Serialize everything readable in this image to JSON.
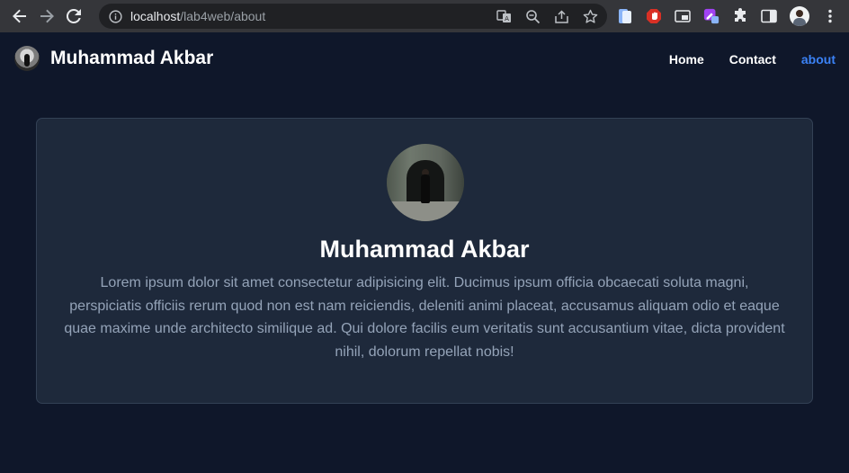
{
  "browser": {
    "url_host": "localhost",
    "url_path": "/lab4web/about"
  },
  "site": {
    "brand_name": "Muhammad Akbar",
    "menu": [
      {
        "label": "Home",
        "active": false
      },
      {
        "label": "Contact",
        "active": false
      },
      {
        "label": "about",
        "active": true
      }
    ]
  },
  "card": {
    "title": "Muhammad Akbar",
    "text": "Lorem ipsum dolor sit amet consectetur adipisicing elit. Ducimus ipsum officia obcaecati soluta magni, perspiciatis officiis rerum quod non est nam reiciendis, deleniti animi placeat, accusamus aliquam odio et eaque quae maxime unde architecto similique ad. Qui dolore facilis eum veritatis sunt accusantium vitae, dicta provident nihil, dolorum repellat nobis!"
  },
  "colors": {
    "page_bg": "#0f172a",
    "card_bg": "#1e293b",
    "active_link": "#3b82f6",
    "body_text": "#94a3b8"
  },
  "icons": [
    "back-arrow-icon",
    "forward-arrow-icon",
    "reload-icon",
    "info-icon",
    "translate-icon",
    "zoom-icon",
    "share-icon",
    "bookmark-star-icon",
    "extensions-puzzle-icon",
    "side-panel-icon",
    "kebab-menu-icon"
  ]
}
